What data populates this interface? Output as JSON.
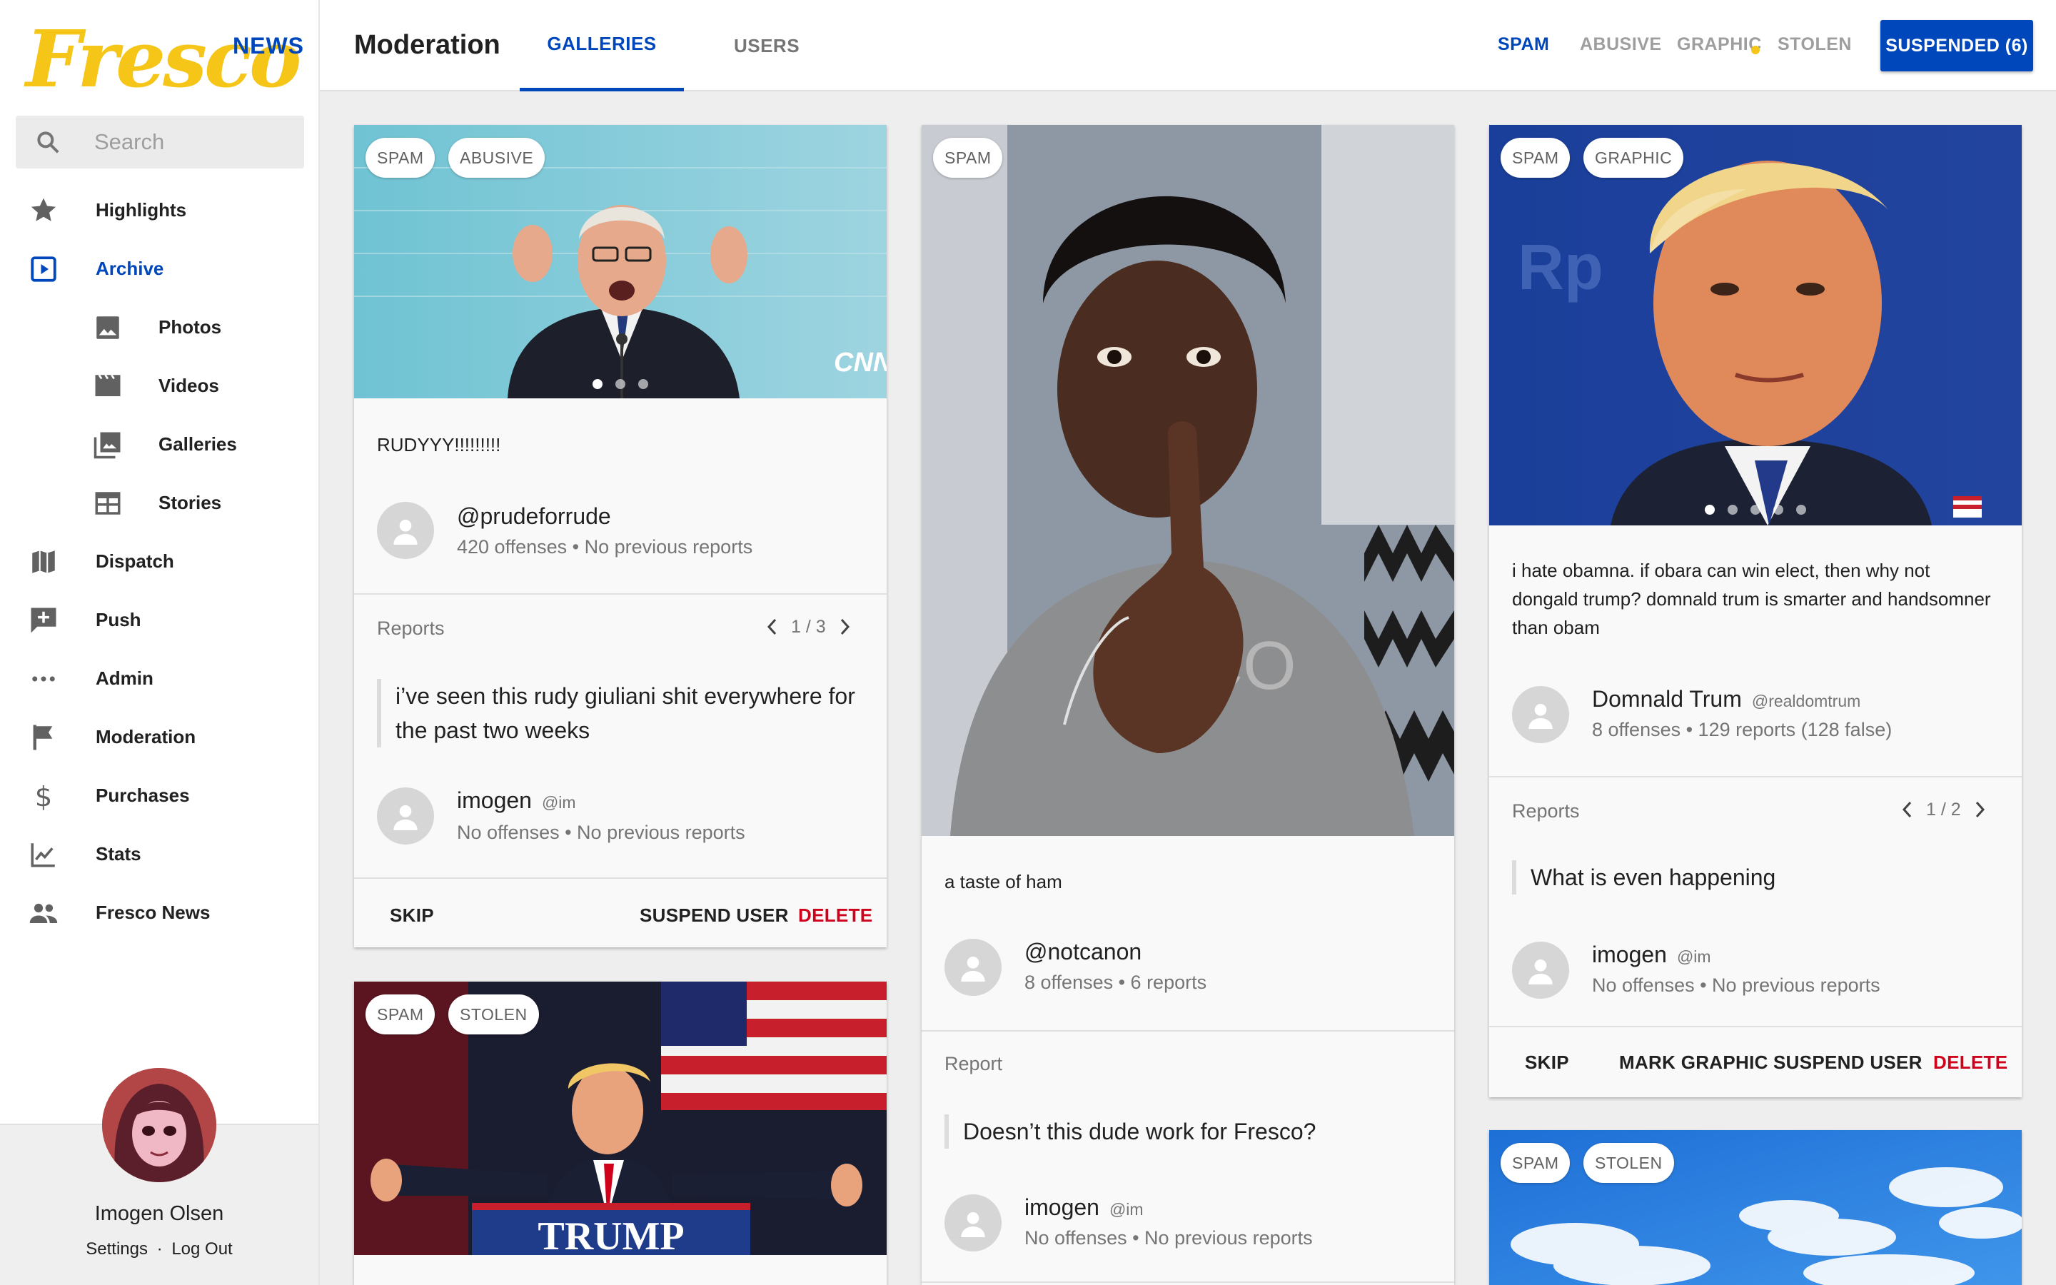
{
  "sidebar": {
    "logo_text": "Fresco",
    "logo_news": "NEWS",
    "search_placeholder": "Search",
    "items": [
      {
        "label": "Highlights",
        "icon": "star-icon"
      },
      {
        "label": "Archive",
        "icon": "play-box-icon",
        "active": true
      },
      {
        "label": "Photos",
        "icon": "image-icon"
      },
      {
        "label": "Videos",
        "icon": "film-icon"
      },
      {
        "label": "Galleries",
        "icon": "gallery-icon"
      },
      {
        "label": "Stories",
        "icon": "stories-icon"
      },
      {
        "label": "Dispatch",
        "icon": "map-icon"
      },
      {
        "label": "Push",
        "icon": "add-comment-icon"
      },
      {
        "label": "Admin",
        "icon": "more-horizontal-icon"
      },
      {
        "label": "Moderation",
        "icon": "flag-icon"
      },
      {
        "label": "Purchases",
        "icon": "dollar-icon"
      },
      {
        "label": "Stats",
        "icon": "chart-line-icon"
      },
      {
        "label": "Fresco News",
        "icon": "people-icon"
      }
    ],
    "profile": {
      "name": "Imogen Olsen",
      "settings": "Settings",
      "separator": "·",
      "logout": "Log Out"
    }
  },
  "header": {
    "title": "Moderation",
    "tabs": [
      {
        "label": "GALLERIES",
        "active": true
      },
      {
        "label": "USERS",
        "active": false
      }
    ],
    "filters": [
      {
        "label": "SPAM",
        "active": true
      },
      {
        "label": "ABUSIVE",
        "active": false
      },
      {
        "label": "GRAPHIC",
        "active": false
      },
      {
        "label": "STOLEN",
        "active": false
      }
    ],
    "suspended_button": "SUSPENDED (6)"
  },
  "colors": {
    "brand_blue": "#0047bb",
    "brand_yellow": "#f5c518",
    "delete_red": "#d0021b"
  },
  "cards": [
    {
      "chips": [
        "SPAM",
        "ABUSIVE"
      ],
      "caption": "RUDYYY!!!!!!!!!",
      "owner": {
        "name": "@prudeforrude",
        "meta": "420 offenses • No previous reports"
      },
      "reports_label": "Reports",
      "pager": "1 / 3",
      "report_text": "i’ve seen this rudy giuliani shit everywhere for the past two weeks",
      "reporter": {
        "name": "imogen",
        "handle": "@im",
        "meta": "No offenses • No previous reports"
      },
      "actions": {
        "skip": "SKIP",
        "suspend": "SUSPEND USER",
        "delete": "DELETE"
      },
      "image_watermark": "CNN"
    },
    {
      "chips": [
        "SPAM"
      ],
      "caption": "a taste of ham",
      "owner": {
        "name": "@notcanon",
        "meta": "8 offenses • 6 reports"
      },
      "reports_label": "Report",
      "report_text": "Doesn’t this dude work for Fresco?",
      "reporter": {
        "name": "imogen",
        "handle": "@im",
        "meta": "No offenses • No previous reports"
      }
    },
    {
      "chips": [
        "SPAM",
        "GRAPHIC"
      ],
      "caption": "i hate obamna. if obara can win elect, then why not dongald trump? domnald trum is smarter and handsomner than obam",
      "owner": {
        "name": "Domnald Trum",
        "handle": "@realdomtrum",
        "meta": "8 offenses • 129 reports (128 false)"
      },
      "reports_label": "Reports",
      "pager": "1 / 2",
      "report_text": "What is even happening",
      "reporter": {
        "name": "imogen",
        "handle": "@im",
        "meta": "No offenses • No previous reports"
      },
      "actions": {
        "skip": "SKIP",
        "mark_graphic": "MARK GRAPHIC",
        "suspend": "SUSPEND USER",
        "delete": "DELETE"
      }
    },
    {
      "chips": [
        "SPAM",
        "STOLEN"
      ],
      "image_sign": "TRUMP"
    },
    {
      "chips": [
        "SPAM",
        "STOLEN"
      ]
    }
  ]
}
